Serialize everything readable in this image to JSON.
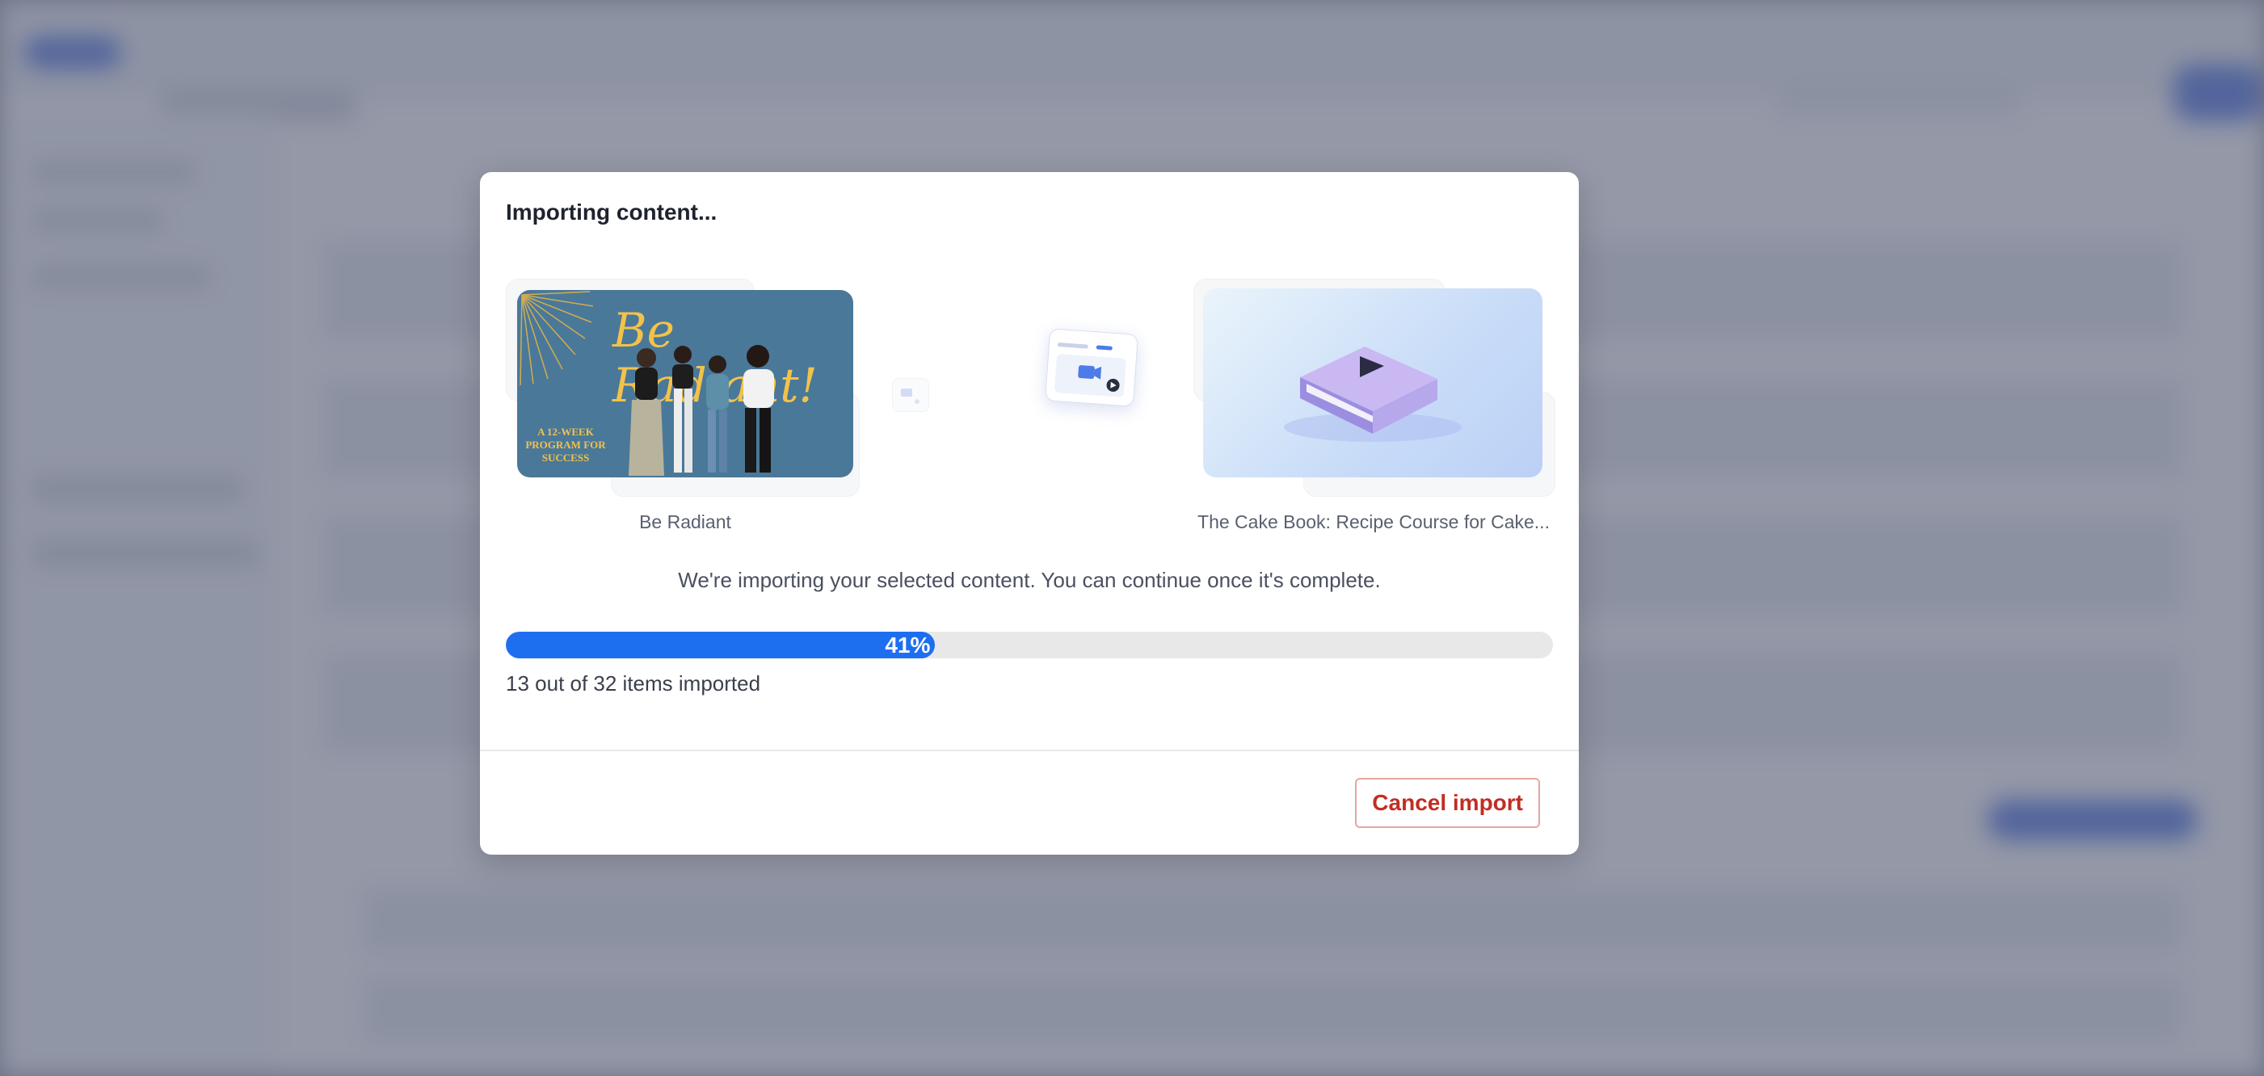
{
  "modal": {
    "title": "Importing content...",
    "source_course": {
      "name": "Be Radiant",
      "thumbnail_title": "Be Radiant!",
      "thumbnail_subtitle": "A 12-WEEK PROGRAM FOR SUCCESS"
    },
    "destination_course": {
      "name": "The Cake Book: Recipe Course for Cake..."
    },
    "message": "We're importing your selected content. You can continue once it's complete.",
    "progress": {
      "percent_label": "41%",
      "fraction": 0.41,
      "count_text": "13 out of 32 items imported"
    },
    "cancel_label": "Cancel import"
  },
  "colors": {
    "progress_fill": "#1e6ff0",
    "cancel_text": "#c22d23",
    "cancel_border": "#e7a6a2",
    "thumbnail_left_bg": "#4a7898",
    "thumbnail_left_text": "#f2c24b"
  },
  "icons": [
    "video-card-icon",
    "play-book-icon",
    "sunburst-decoration",
    "people-illustration"
  ]
}
